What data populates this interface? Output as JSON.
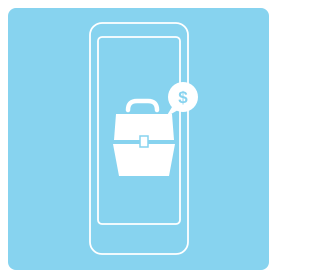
{
  "colors": {
    "background": "#87d3ef",
    "line": "#ffffff"
  },
  "illustration": {
    "phone_icon": "smartphone-icon",
    "bag_icon": "briefcase-icon",
    "bubble_icon": "speech-bubble-icon",
    "currency_symbol": "$"
  }
}
